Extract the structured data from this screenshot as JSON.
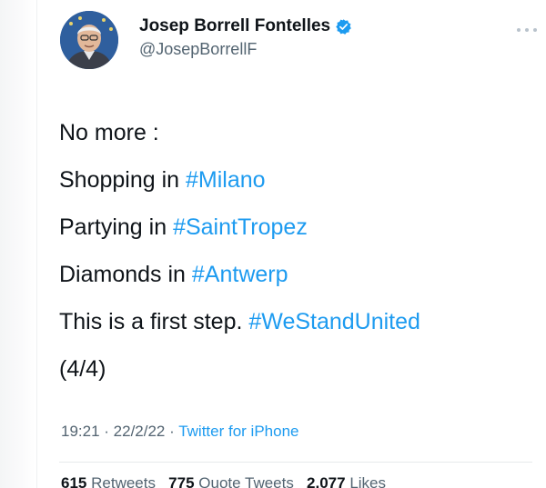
{
  "author": {
    "display_name": "Josep Borrell Fontelles",
    "handle": "@JosepBorrellF"
  },
  "tweet": {
    "lines": {
      "l1": {
        "text": "No more :"
      },
      "l2": {
        "text": "Shopping in ",
        "hashtag": "#Milano"
      },
      "l3": {
        "text": "Partying in ",
        "hashtag": "#SaintTropez"
      },
      "l4": {
        "text": "Diamonds in ",
        "hashtag": "#Antwerp"
      },
      "l5": {
        "text": "This is a first step. ",
        "hashtag": "#WeStandUnited"
      },
      "l6": {
        "text": "(4/4)"
      }
    }
  },
  "meta": {
    "time": "19:21",
    "date": "22/2/22",
    "separator": " · ",
    "source": "Twitter for iPhone"
  },
  "stats": {
    "retweets_count": "615",
    "retweets_label": "Retweets",
    "quotes_count": "775",
    "quotes_label": "Quote Tweets",
    "likes_count": "2,077",
    "likes_label": "Likes"
  },
  "colors": {
    "accent": "#1d9bf0",
    "text": "#0f1419",
    "secondary": "#536471"
  },
  "icons": {
    "verified": "verified-badge-icon",
    "more": "more-options-icon"
  }
}
